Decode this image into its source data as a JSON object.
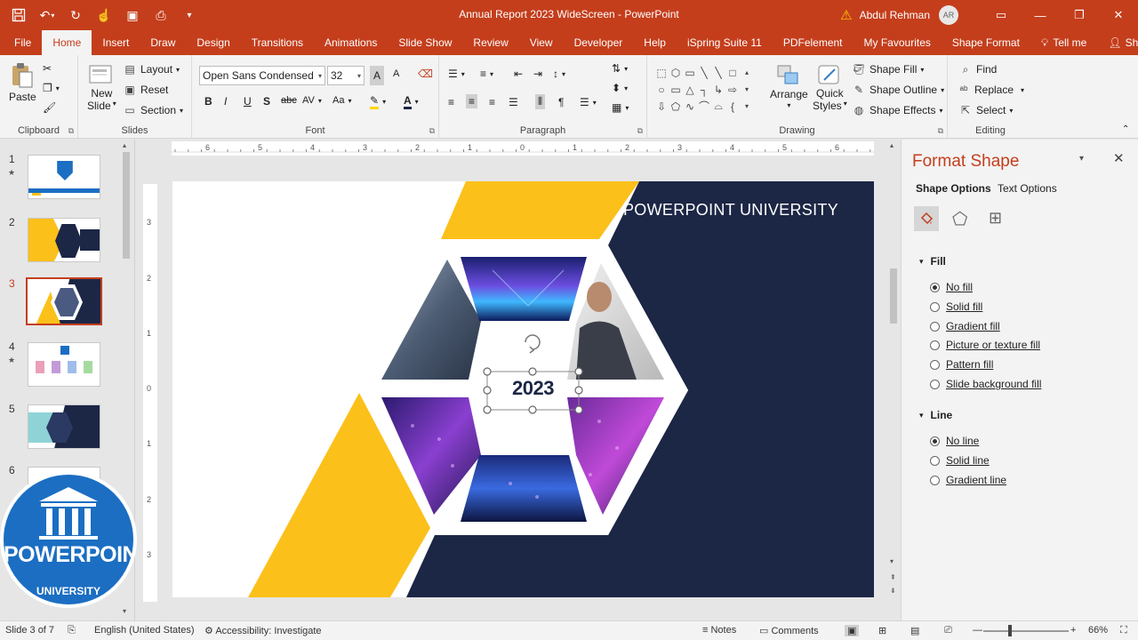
{
  "title_bar": {
    "document_title": "Annual Report 2023 WideScreen  -  PowerPoint",
    "user_name": "Abdul Rehman",
    "user_initials": "AR",
    "qat_icons": [
      "save-icon",
      "undo-icon",
      "redo-icon",
      "touch-mode-icon",
      "record-icon",
      "print-preview-icon",
      "customize-qat-icon"
    ]
  },
  "ribbon_tabs": [
    "File",
    "Home",
    "Insert",
    "Draw",
    "Design",
    "Transitions",
    "Animations",
    "Slide Show",
    "Review",
    "View",
    "Developer",
    "Help",
    "iSpring Suite 11",
    "PDFelement",
    "My Favourites",
    "Shape Format"
  ],
  "active_tab": "Home",
  "tell_me": "Tell me",
  "share": "Share",
  "ribbon": {
    "clipboard": {
      "label": "Clipboard",
      "paste": "Paste"
    },
    "slides": {
      "label": "Slides",
      "new_slide_1": "New",
      "new_slide_2": "Slide",
      "layout": "Layout",
      "reset": "Reset",
      "section": "Section"
    },
    "font": {
      "label": "Font",
      "font_name": "Open Sans Condensed",
      "font_size": "32"
    },
    "paragraph": {
      "label": "Paragraph"
    },
    "drawing": {
      "label": "Drawing",
      "arrange": "Arrange",
      "quick_styles_1": "Quick",
      "quick_styles_2": "Styles",
      "shape_fill": "Shape Fill",
      "shape_outline": "Shape Outline",
      "shape_effects": "Shape Effects"
    },
    "editing": {
      "label": "Editing",
      "find": "Find",
      "replace": "Replace",
      "select": "Select"
    }
  },
  "thumbnails": [
    {
      "num": "1",
      "star": "★"
    },
    {
      "num": "2",
      "star": ""
    },
    {
      "num": "3",
      "star": ""
    },
    {
      "num": "4",
      "star": "★"
    },
    {
      "num": "5",
      "star": ""
    },
    {
      "num": "6",
      "star": ""
    }
  ],
  "logo": {
    "main": "POWERPOINT",
    "sub": "UNIVERSITY"
  },
  "slide": {
    "header_text": "POWERPOINT UNIVERSITY",
    "year_text": "2023",
    "colors": {
      "navy": "#1c2645",
      "yellow": "#fcc01a"
    }
  },
  "rulers": {
    "horizontal": [
      "6",
      "5",
      "4",
      "3",
      "2",
      "1",
      "0",
      "1",
      "2",
      "3",
      "4",
      "5",
      "6"
    ],
    "vertical": [
      "3",
      "2",
      "1",
      "0",
      "1",
      "2",
      "3"
    ]
  },
  "format_pane": {
    "title": "Format Shape",
    "tab_shape": "Shape Options",
    "tab_text": "Text Options",
    "fill_header": "Fill",
    "fill_options": [
      "No fill",
      "Solid fill",
      "Gradient fill",
      "Picture or texture fill",
      "Pattern fill",
      "Slide background fill"
    ],
    "line_header": "Line",
    "line_options": [
      "No line",
      "Solid line",
      "Gradient line"
    ]
  },
  "status": {
    "slide_of": "Slide 3 of 7",
    "language": "English (United States)",
    "accessibility": "Accessibility: Investigate",
    "notes": "Notes",
    "comments": "Comments",
    "zoom": "66%"
  }
}
